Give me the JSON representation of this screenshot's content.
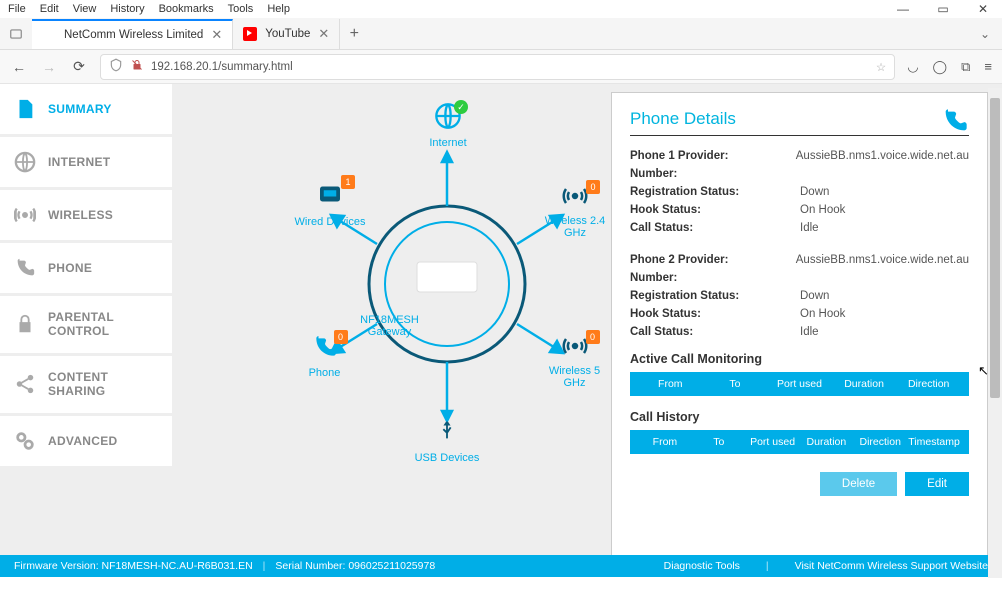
{
  "browser": {
    "menu": [
      "File",
      "Edit",
      "View",
      "History",
      "Bookmarks",
      "Tools",
      "Help"
    ],
    "window_controls": {
      "min": "—",
      "max": "▭",
      "close": "✕"
    },
    "tabs": [
      {
        "title": "NetComm Wireless Limited",
        "active": true,
        "favicon": "nc"
      },
      {
        "title": "YouTube",
        "active": false,
        "favicon": "yt"
      }
    ],
    "url": "192.168.20.1/summary.html",
    "nav": {
      "back": "←",
      "forward": "→",
      "reload": "⟳"
    }
  },
  "sidebar": {
    "items": [
      {
        "label": "SUMMARY",
        "icon": "doc",
        "active": true
      },
      {
        "label": "INTERNET",
        "icon": "globe"
      },
      {
        "label": "WIRELESS",
        "icon": "wifi"
      },
      {
        "label": "PHONE",
        "icon": "phone"
      },
      {
        "label": "PARENTAL CONTROL",
        "icon": "lock"
      },
      {
        "label": "CONTENT SHARING",
        "icon": "share"
      },
      {
        "label": "ADVANCED",
        "icon": "gears"
      }
    ]
  },
  "diagram": {
    "gateway": {
      "line1": "NF18MESH",
      "line2": "Gateway"
    },
    "nodes": {
      "internet": {
        "label": "Internet",
        "status": "ok"
      },
      "wired": {
        "label": "Wired Devices",
        "badge": "1"
      },
      "wireless24": {
        "line1": "Wireless 2.4",
        "line2": "GHz",
        "badge": "0"
      },
      "wireless5": {
        "label": "Wireless 5 GHz",
        "badge": "0"
      },
      "phone": {
        "label": "Phone",
        "badge": "0"
      },
      "usb": {
        "label": "USB Devices"
      }
    }
  },
  "phone": {
    "title": "Phone Details",
    "providers": [
      {
        "heading": "Phone 1 Provider:",
        "name": "AussieBB.nms1.voice.wide.net.au",
        "number_label": "Number:",
        "number": "",
        "reg_label": "Registration Status:",
        "reg": "Down",
        "hook_label": "Hook Status:",
        "hook": "On Hook",
        "call_label": "Call Status:",
        "call": "Idle"
      },
      {
        "heading": "Phone 2 Provider:",
        "name": "AussieBB.nms1.voice.wide.net.au",
        "number_label": "Number:",
        "number": "",
        "reg_label": "Registration Status:",
        "reg": "Down",
        "hook_label": "Hook Status:",
        "hook": "On Hook",
        "call_label": "Call Status:",
        "call": "Idle"
      }
    ],
    "active_monitoring": {
      "title": "Active Call Monitoring",
      "cols": [
        "From",
        "To",
        "Port used",
        "Duration",
        "Direction"
      ]
    },
    "history": {
      "title": "Call History",
      "cols": [
        "From",
        "To",
        "Port used",
        "Duration",
        "Direction",
        "Timestamp"
      ]
    },
    "buttons": {
      "delete": "Delete",
      "edit": "Edit"
    }
  },
  "footer": {
    "firmware_label": "Firmware Version:",
    "firmware": "NF18MESH-NC.AU-R6B031.EN",
    "serial_label": "Serial Number:",
    "serial": "096025211025978",
    "diag": "Diagnostic Tools",
    "support": "Visit NetComm Wireless Support Website"
  }
}
